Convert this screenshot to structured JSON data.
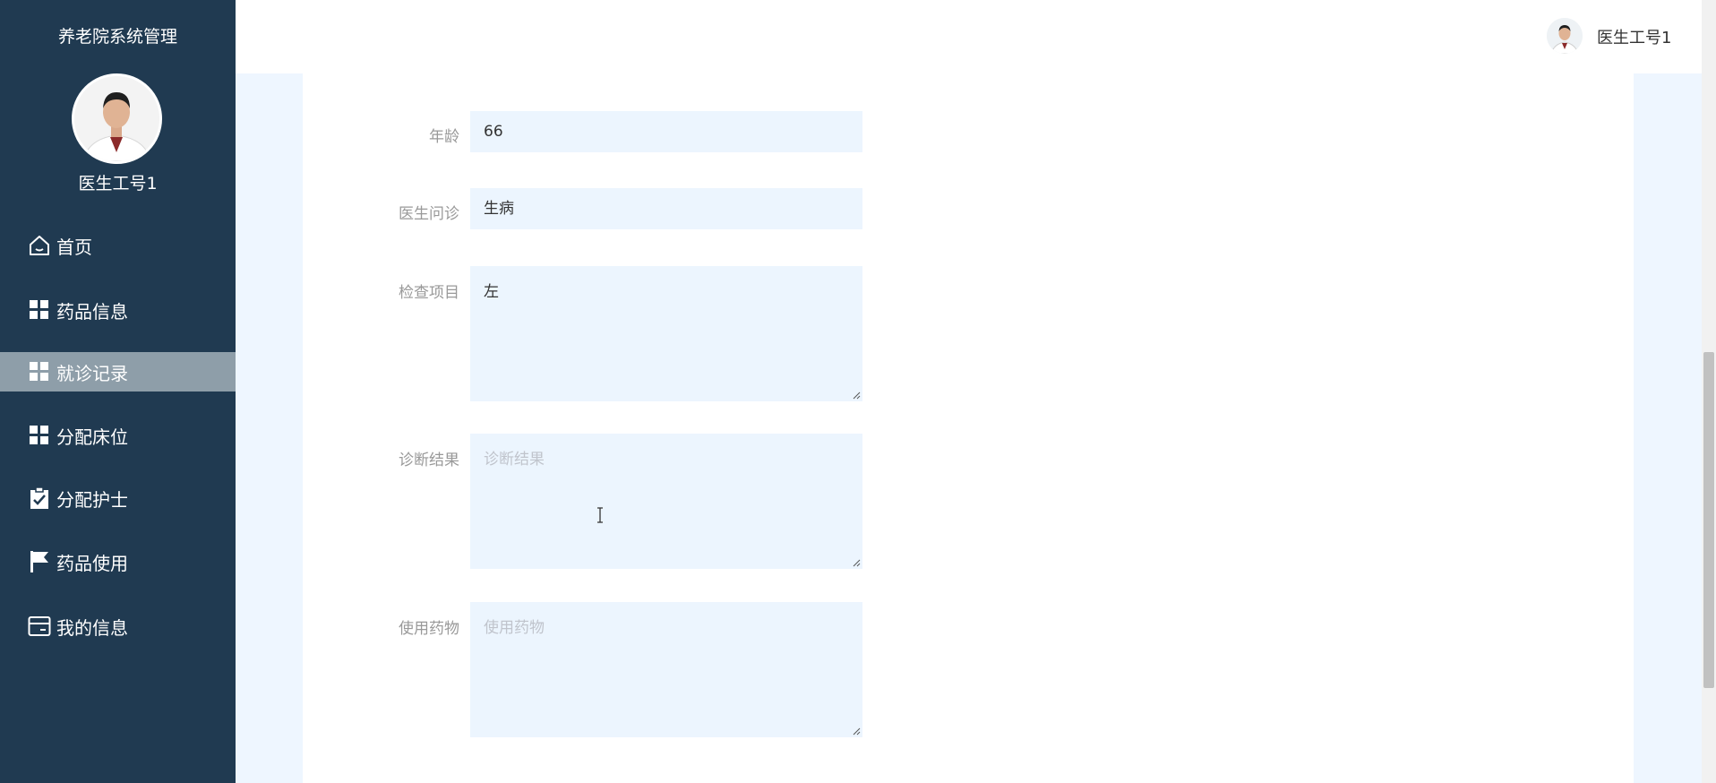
{
  "sidebar": {
    "system_title": "养老院系统管理",
    "user_name": "医生工号1",
    "menu": [
      {
        "label": "首页",
        "icon": "home-icon"
      },
      {
        "label": "药品信息",
        "icon": "grid-icon"
      },
      {
        "label": "就诊记录",
        "icon": "grid-icon",
        "active": true
      },
      {
        "label": "分配床位",
        "icon": "grid-icon"
      },
      {
        "label": "分配护士",
        "icon": "clipboard-check-icon"
      },
      {
        "label": "药品使用",
        "icon": "flag-icon"
      },
      {
        "label": "我的信息",
        "icon": "card-icon"
      }
    ]
  },
  "topbar": {
    "user_name": "医生工号1"
  },
  "form": {
    "age": {
      "label": "年龄",
      "value": "66"
    },
    "inquiry": {
      "label": "医生问诊",
      "value": "生病"
    },
    "exam": {
      "label": "检查项目",
      "value": "左"
    },
    "diagnosis": {
      "label": "诊断结果",
      "placeholder": "诊断结果"
    },
    "medication": {
      "label": "使用药物",
      "placeholder": "使用药物"
    }
  },
  "colors": {
    "sidebar_bg": "#203a51",
    "active_item_bg": "#8e9ea9",
    "input_bg": "#ecf5fe",
    "page_bg": "#eef6ff"
  }
}
